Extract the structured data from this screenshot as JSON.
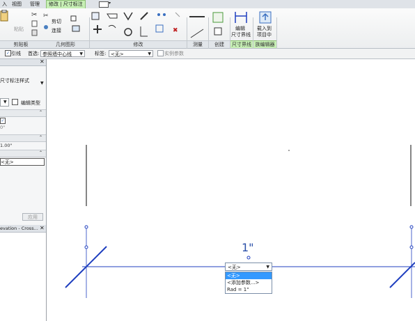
{
  "tabs": [
    "入",
    "视图",
    "管理",
    "修改 | 尺寸标注"
  ],
  "ribbon": {
    "paste_label": "粘贴",
    "cut_label": "剪切",
    "join_label": "连接",
    "panels": [
      "剪贴板",
      "几何图形",
      "修改",
      "测量",
      "创建",
      "尺寸界线",
      "族编辑器"
    ],
    "edit_witness": [
      "编辑",
      "尺寸界线"
    ],
    "load_project": [
      "载入到",
      "项目中"
    ]
  },
  "options_bar": {
    "leader_label": "引线",
    "preference_label": "首选:",
    "preference_value": "参照墙中心线",
    "label_label": "标签:",
    "label_value": "<无>",
    "instance_param_label": "实例参数"
  },
  "properties": {
    "type_text": "尺寸标注样式",
    "edit_type_label": "编辑类型",
    "value_1": "0\"",
    "value_2": "1.00\"",
    "value_3": "<无>",
    "apply_label": "应用"
  },
  "browser": {
    "item": "evation - Cross..."
  },
  "canvas": {
    "dimension_text": "1\"",
    "dropdown_value": "<无>",
    "dropdown_options": [
      "<无>",
      "<添加参数...>",
      "Rad = 1\""
    ],
    "selected_index": 0
  },
  "colors": {
    "accent_green": "#c7efb5",
    "line_blue": "#1f3fbf",
    "selection_blue": "#3399ff"
  }
}
